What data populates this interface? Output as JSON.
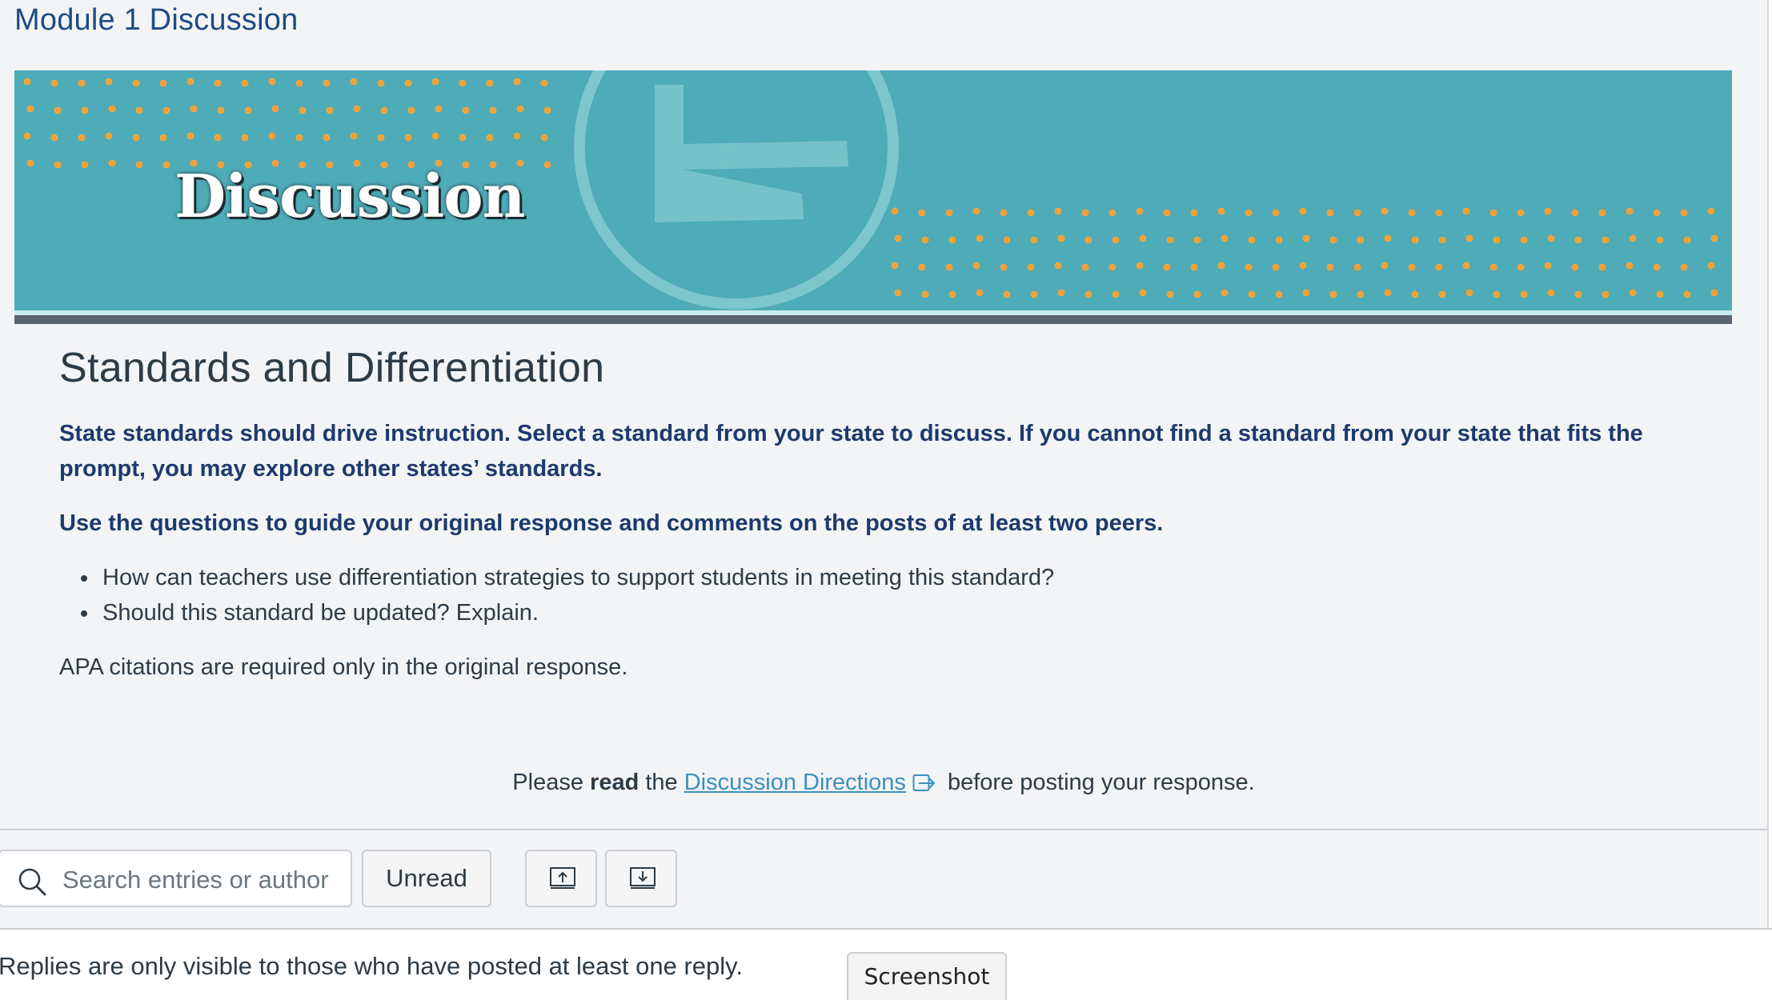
{
  "module_title": "Module 1 Discussion",
  "banner": {
    "word": "Discussion",
    "colors": {
      "background": "#4eabb8",
      "dots": "#f0a23a",
      "logo": "#86cfd6",
      "bar": "#5b6470"
    }
  },
  "content": {
    "heading": "Standards and Differentiation",
    "lead": "State standards should drive instruction. Select a standard from your state to discuss. If you cannot find a standard from your state that fits the prompt, you may explore other states’ standards.",
    "lead2": "Use the questions to guide your original response and comments on the posts of at least two peers.",
    "questions": [
      "How can teachers use differentiation strategies to support students in meeting this standard?",
      "Should this standard be updated? Explain."
    ],
    "apa": "APA citations are required only in the original response.",
    "read_line": {
      "before": "Please ",
      "bold": "read",
      "middle": " the ",
      "link": "Discussion Directions",
      "after": " before posting your response."
    }
  },
  "toolbar": {
    "search_placeholder": "Search entries or author",
    "search_value": "",
    "unread_label": "Unread",
    "sort_up_icon": "sort-ascending-icon",
    "sort_down_icon": "sort-descending-icon"
  },
  "notice": "Replies are only visible to those who have posted at least one reply.",
  "screenshot_tab": "Screenshot"
}
